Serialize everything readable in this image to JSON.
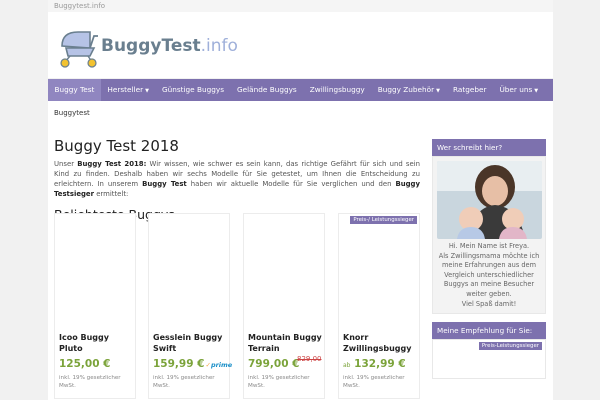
{
  "site": {
    "topbar_text": "Buggytest.info",
    "logo_main": "BuggyTest",
    "logo_suffix": ".info"
  },
  "nav": {
    "items": [
      {
        "label": "Buggy Test",
        "active": true
      },
      {
        "label": "Hersteller",
        "has_caret": true
      },
      {
        "label": "Günstige Buggys"
      },
      {
        "label": "Gelände Buggys"
      },
      {
        "label": "Zwillingsbuggy"
      },
      {
        "label": "Buggy Zubehör",
        "has_caret": true
      },
      {
        "label": "Ratgeber"
      },
      {
        "label": "Über uns",
        "has_caret": true
      }
    ]
  },
  "breadcrumb": "Buggytest",
  "main": {
    "title": "Buggy Test 2018",
    "intro_prefix": "Unser ",
    "intro_bold1": "Buggy Test 2018:",
    "intro_mid": " Wir wissen, wie schwer es sein kann, das richtige Gefährt für sich und sein Kind zu finden. Deshalb haben wir sechs Modelle für Sie getestet, um Ihnen die Entscheidung zu erleichtern. In unserem ",
    "intro_bold2": "Buggy Test",
    "intro_mid2": " haben wir aktuelle Modelle für Sie verglichen und den ",
    "intro_bold3": "Buggy Testsieger",
    "intro_suffix": " ermittelt:",
    "section_title": "Beliebteste Buggys"
  },
  "products": [
    {
      "name": "Icoo Buggy Pluto",
      "price": "125,00 €",
      "tax": "inkl. 19% gesetzlicher MwSt."
    },
    {
      "name": "Gesslein Buggy Swift",
      "price": "159,99 €",
      "prime": "prime",
      "tax": "inkl. 19% gesetzlicher MwSt."
    },
    {
      "name": "Mountain Buggy Terrain",
      "price": "799,00 €",
      "old_price": "829,00",
      "tax": "inkl. 19% gesetzlicher MwSt."
    },
    {
      "name": "Knorr Zwillingsbuggy",
      "price_prefix": "ab",
      "price": "132,99 €",
      "badge": "Preis-/ Leistungssieger",
      "tax": "inkl. 19% gesetzlicher MwSt."
    }
  ],
  "sidebar": {
    "widget1_title": "Wer schreibt hier?",
    "about_line1": "Hi. Mein Name ist Freya.",
    "about_line2": "Als Zwillingsmama möchte ich meine Erfahrungen aus dem Vergleich unterschiedlicher Buggys an meine Besucher weiter geben.",
    "about_line3": "Viel Spaß damit!",
    "widget2_title": "Meine Empfehlung für Sie:",
    "widget2_badge": "Preis-Leistungssieger"
  },
  "colors": {
    "nav_bg": "#7d71ae",
    "price_green": "#7ba33a",
    "old_price_red": "#c44444"
  }
}
